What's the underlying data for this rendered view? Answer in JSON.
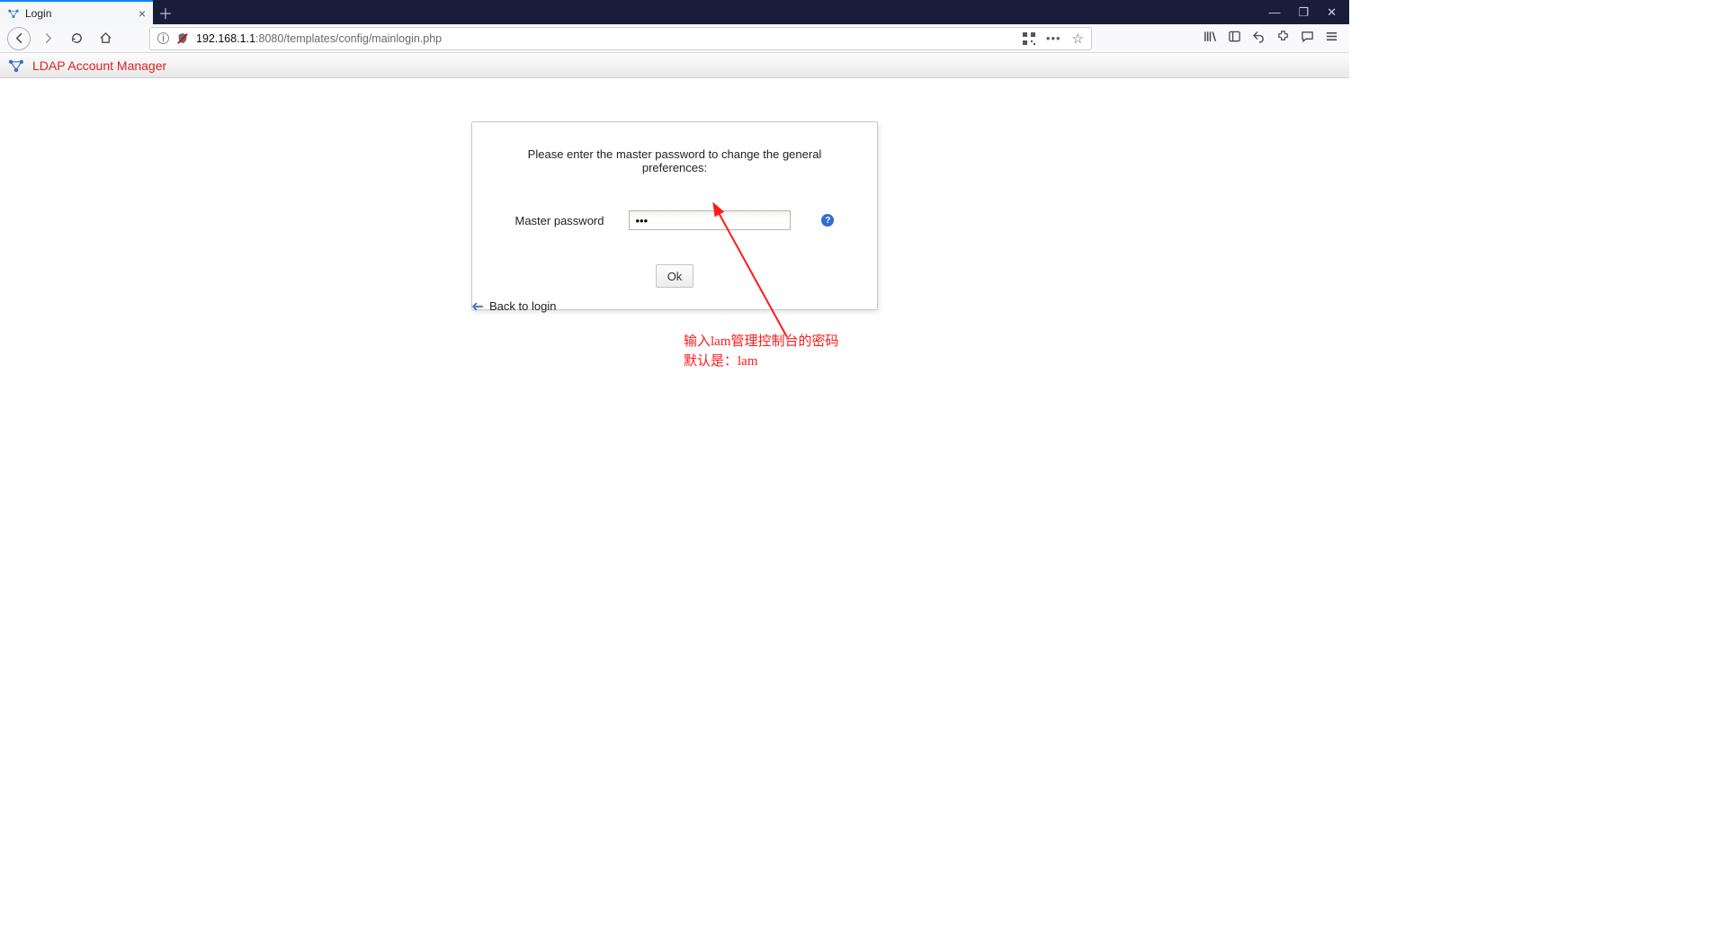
{
  "browser": {
    "tab_title": "Login",
    "url_full": "192.168.1.1:8080/templates/config/mainlogin.php",
    "url_host": "192.168.1.1",
    "url_port_path": ":8080/templates/config/mainlogin.php"
  },
  "app": {
    "header_title": "LDAP Account Manager"
  },
  "form": {
    "prompt": "Please enter the master password to change the general preferences:",
    "label": "Master password",
    "password_value": "•••",
    "ok_label": "Ok"
  },
  "backlink": {
    "label": "Back to login"
  },
  "annotation": {
    "line1": "输入lam管理控制台的密码",
    "line2": "默认是：lam"
  }
}
